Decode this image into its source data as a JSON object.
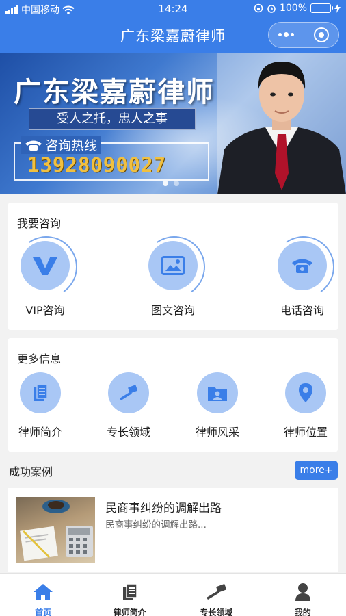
{
  "status_bar": {
    "carrier": "中国移动",
    "time": "14:24",
    "battery": "100%"
  },
  "nav": {
    "title": "广东梁嘉蔚律师"
  },
  "banner": {
    "title": "广东梁嘉蔚律师",
    "slogan": "受人之托，忠人之事",
    "hotline_label": "咨询热线",
    "phone": "13928090027"
  },
  "consult": {
    "title": "我要咨询",
    "items": [
      {
        "label": "VIP咨询",
        "icon": "vip-icon"
      },
      {
        "label": "图文咨询",
        "icon": "image-icon"
      },
      {
        "label": "电话咨询",
        "icon": "telephone-icon"
      }
    ]
  },
  "more_info": {
    "title": "更多信息",
    "items": [
      {
        "label": "律师简介",
        "icon": "document-icon"
      },
      {
        "label": "专长领域",
        "icon": "gavel-icon"
      },
      {
        "label": "律师风采",
        "icon": "folder-person-icon"
      },
      {
        "label": "律师位置",
        "icon": "location-pin-icon"
      }
    ]
  },
  "cases": {
    "title": "成功案例",
    "more_label": "more+",
    "items": [
      {
        "title": "民商事纠纷的调解出路",
        "desc": "民商事纠纷的调解出路..."
      }
    ]
  },
  "tabbar": {
    "items": [
      {
        "label": "首页",
        "icon": "home-icon",
        "active": true
      },
      {
        "label": "律师简介",
        "icon": "document-icon",
        "active": false
      },
      {
        "label": "专长领域",
        "icon": "gavel-icon",
        "active": false
      },
      {
        "label": "我的",
        "icon": "user-icon",
        "active": false
      }
    ]
  },
  "colors": {
    "primary": "#3a7ee8",
    "icon_circle": "#a9c7f5",
    "phone_gold": "#f1c040"
  }
}
